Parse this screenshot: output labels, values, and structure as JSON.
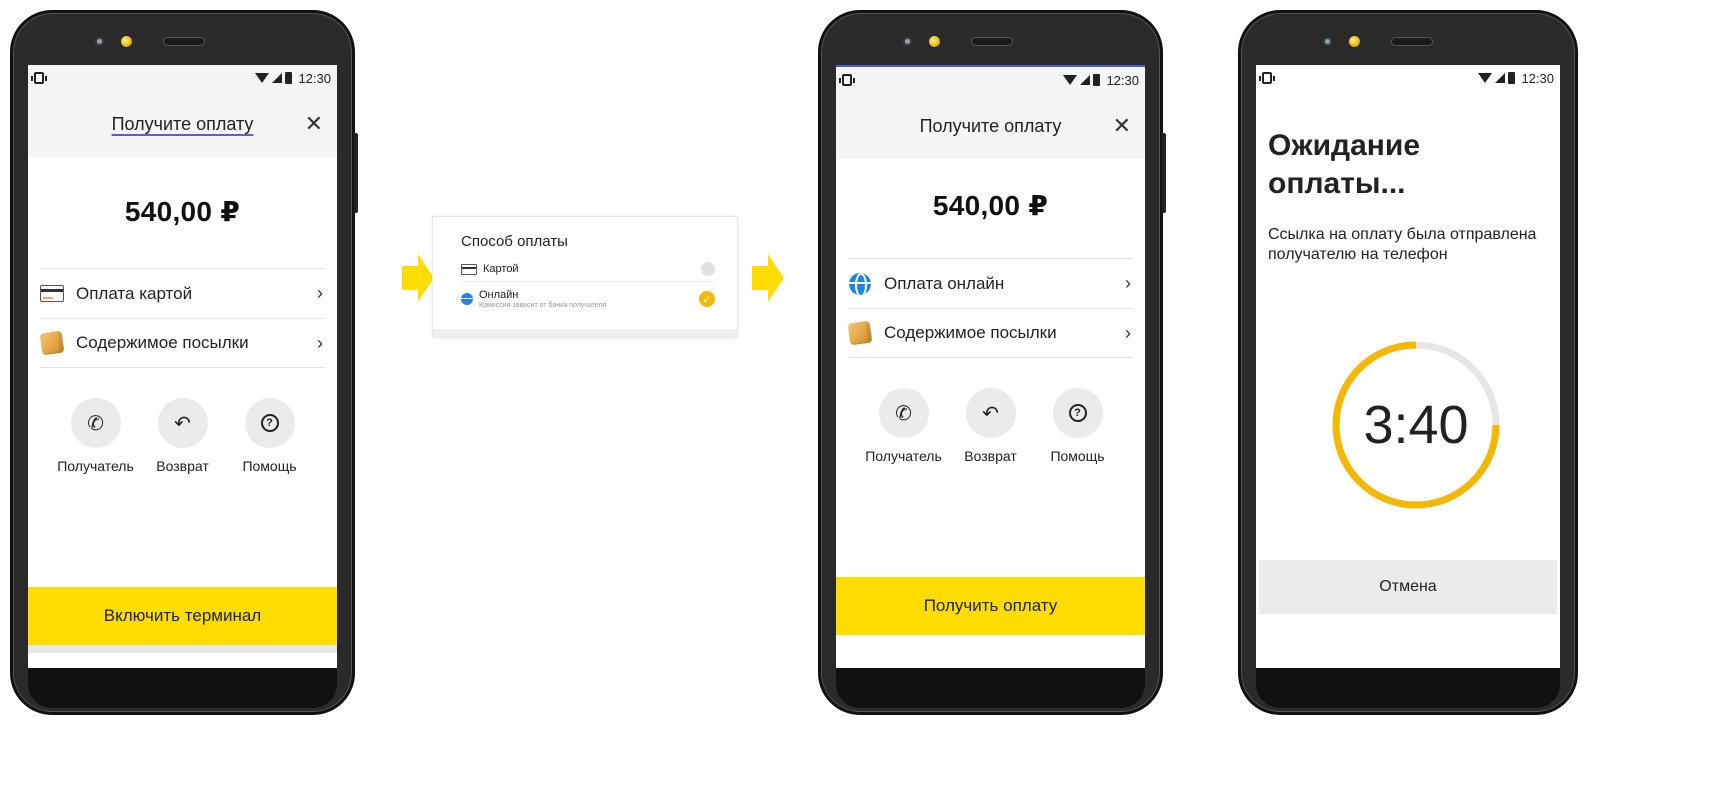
{
  "status": {
    "time": "12:30"
  },
  "screen1": {
    "title": "Получите оплату",
    "close": "✕",
    "amount": "540,00 ₽",
    "rows": [
      {
        "label": "Оплата картой",
        "icon": "card-icon"
      },
      {
        "label": "Содержимое посылки",
        "icon": "package-icon"
      }
    ],
    "actions": [
      {
        "label": "Получатель",
        "icon": "phone-icon",
        "glyph": "✆"
      },
      {
        "label": "Возврат",
        "icon": "undo-icon",
        "glyph": "↶"
      },
      {
        "label": "Помощь",
        "icon": "help-icon",
        "glyph": "?"
      }
    ],
    "button": "Включить терминал"
  },
  "popup": {
    "title": "Способ оплаты",
    "options": [
      {
        "label": "Картой",
        "sub": "",
        "selected": false
      },
      {
        "label": "Онлайн",
        "sub": "Комиссия зависит от банка получателя",
        "selected": true
      }
    ]
  },
  "screen3": {
    "title": "Получите оплату",
    "close": "✕",
    "amount": "540,00 ₽",
    "rows": [
      {
        "label": "Оплата онлайн",
        "icon": "globe-icon"
      },
      {
        "label": "Содержимое посылки",
        "icon": "package-icon"
      }
    ],
    "actions": [
      {
        "label": "Получатель",
        "icon": "phone-icon",
        "glyph": "✆"
      },
      {
        "label": "Возврат",
        "icon": "undo-icon",
        "glyph": "↶"
      },
      {
        "label": "Помощь",
        "icon": "help-icon",
        "glyph": "?"
      }
    ],
    "button": "Получить оплату"
  },
  "screen4": {
    "title_line1": "Ожидание",
    "title_line2": "оплаты...",
    "text": "Ссылка на оплату была отправлена получателю на телефон",
    "timer": "3:40",
    "timer_progress": 0.75,
    "button": "Отмена"
  },
  "colors": {
    "accent_yellow": "#ffdd00",
    "timer_orange": "#f5b800",
    "underline_purple": "#6c52e0"
  }
}
